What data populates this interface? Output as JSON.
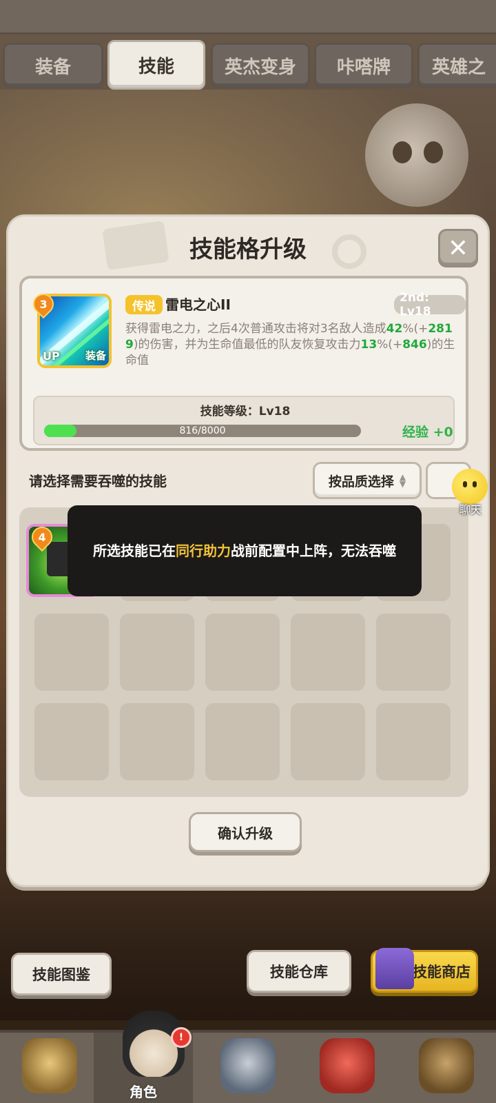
{
  "tabs": [
    "装备",
    "技能",
    "英杰变身",
    "咔嗒牌",
    "英雄之"
  ],
  "active_tab_index": 1,
  "modal": {
    "title": "技能格升级",
    "close_label": "✕"
  },
  "skill": {
    "level_badge": "3",
    "icon_up": "UP",
    "icon_equip": "装备",
    "rarity": "传说",
    "name": "雷电之心II",
    "slot_level": "2nd: Lv18",
    "desc_1": "获得雷电之力，之后4次普通攻击将对3名敌人造成",
    "desc_pct1": "42",
    "desc_plus1": "%(+",
    "desc_val1": "2819",
    "desc_2": ")的伤害，并为生命值最低的队友恢复攻击力",
    "desc_pct2": "13",
    "desc_plus2": "%(+",
    "desc_val2": "846",
    "desc_3": ")的生命值",
    "level_label": "技能等级：Lv18",
    "xp_text": "816/8000",
    "xp_fraction": 0.102,
    "xp_gain": "经验 +0"
  },
  "select": {
    "label": "请选择需要吞噬的技能",
    "quality_button": "按品质选择"
  },
  "grid": {
    "item_level": "4"
  },
  "toast": {
    "part1": "所选技能已在",
    "highlight": "同行助力",
    "part2": "战前配置中上阵，无法吞噬"
  },
  "confirm_button": "确认升级",
  "chat_label": "聊天",
  "bottom_buttons": {
    "codex": "技能图鉴",
    "storage": "技能仓库",
    "shop": "技能商店"
  },
  "nav": {
    "active_label": "角色",
    "notification": "!"
  },
  "colors": {
    "accent_green": "#1faa3a",
    "legendary_gold": "#f5c22b",
    "toast_highlight": "#f0c23a"
  }
}
